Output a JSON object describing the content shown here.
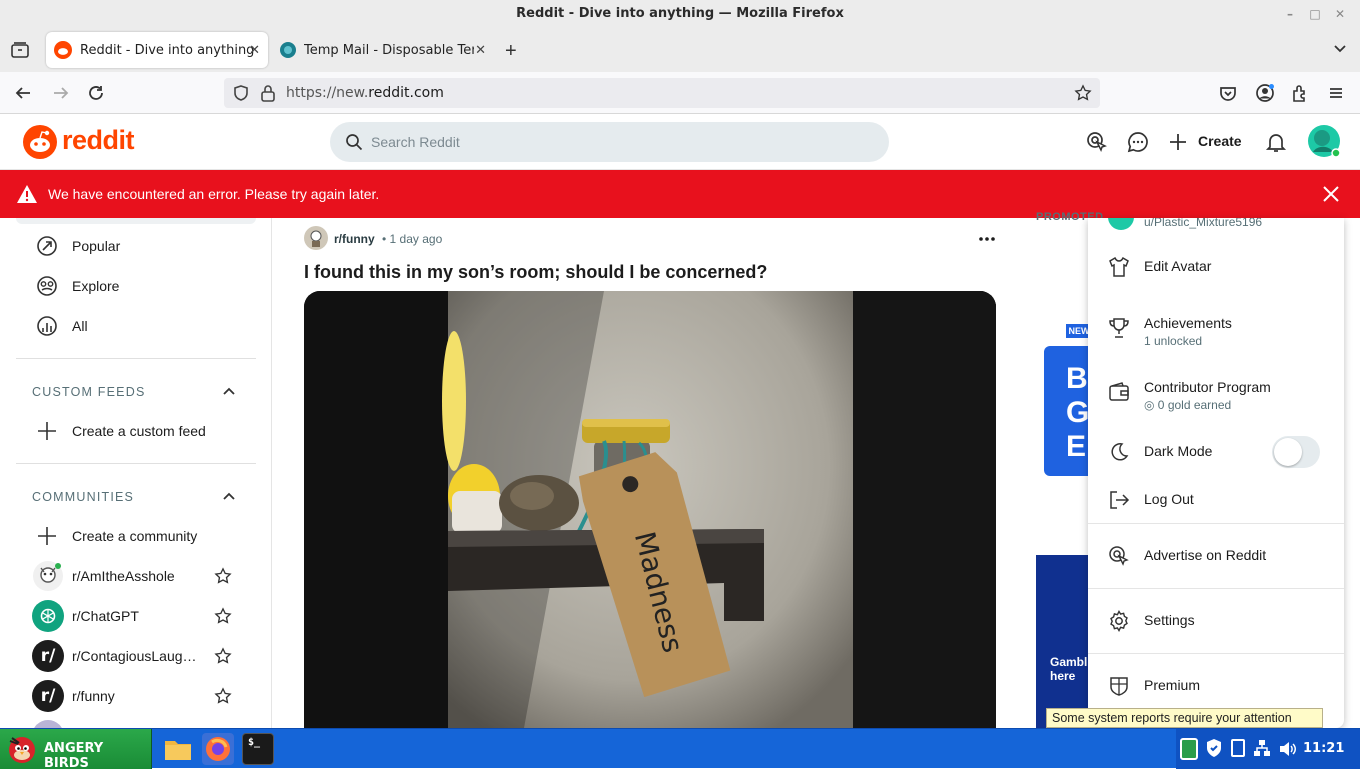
{
  "window": {
    "title": "Reddit - Dive into anything — Mozilla Firefox"
  },
  "tabs": [
    {
      "label": "Reddit - Dive into anything"
    },
    {
      "label": "Temp Mail - Disposable Tem"
    }
  ],
  "url": {
    "prefix": "https://new.",
    "domain": "reddit.com"
  },
  "header": {
    "logo": "reddit",
    "search_placeholder": "Search Reddit",
    "create_label": "Create"
  },
  "error_banner": {
    "text": "We have encountered an error. Please try again later."
  },
  "sidebar": {
    "nav": [
      {
        "label": "Popular",
        "icon": "popular-icon"
      },
      {
        "label": "Explore",
        "icon": "explore-icon"
      },
      {
        "label": "All",
        "icon": "all-icon"
      }
    ],
    "custom_feeds": {
      "heading": "CUSTOM FEEDS",
      "create_label": "Create a custom feed"
    },
    "communities": {
      "heading": "COMMUNITIES",
      "create_label": "Create a community",
      "items": [
        {
          "name": "r/AmItheAsshole"
        },
        {
          "name": "r/ChatGPT"
        },
        {
          "name": "r/ContagiousLaughter"
        },
        {
          "name": "r/funny"
        }
      ]
    }
  },
  "post": {
    "subreddit": "r/funny",
    "time": "• 1 day ago",
    "title": "I found this in my son’s room; should I be concerned?",
    "tag_text": "Madness"
  },
  "right": {
    "promoted": "PROMOTED",
    "ad1_badge": "NEW",
    "ad1_text": "B GE",
    "ad2_text": "Gambl here"
  },
  "user_menu": {
    "username": "u/Plastic_Mixture5196",
    "items": [
      {
        "label": "Edit Avatar"
      },
      {
        "label": "Achievements",
        "sub": "1 unlocked"
      },
      {
        "label": "Contributor Program",
        "sub": "◎ 0 gold earned"
      },
      {
        "label": "Dark Mode",
        "toggle": false
      },
      {
        "label": "Log Out"
      },
      {
        "label": "Advertise on Reddit"
      },
      {
        "label": "Settings"
      },
      {
        "label": "Premium"
      }
    ]
  },
  "tooltip": "Some system reports require your attention",
  "taskbar": {
    "start_label": "ANGERY BIRDS",
    "clock": "11:21"
  },
  "colors": {
    "reddit_orange": "#ff4500",
    "error_red": "#e8111d",
    "taskbar_blue": "#1565d8"
  }
}
